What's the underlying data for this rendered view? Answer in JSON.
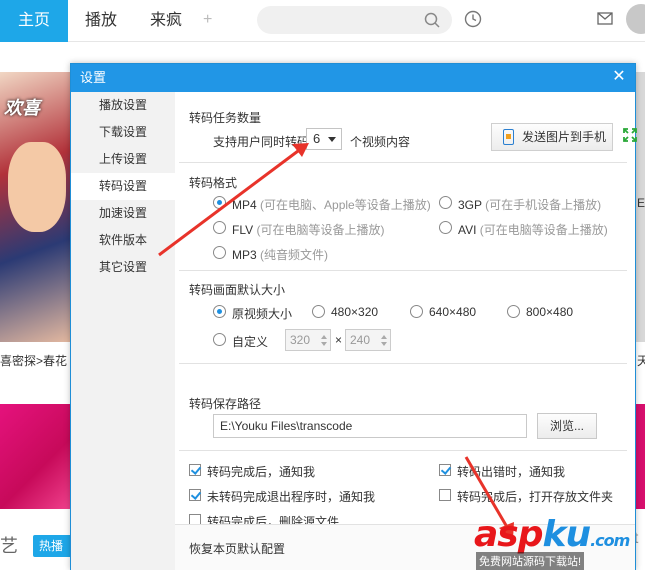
{
  "topbar": {
    "tabs": [
      {
        "label": "主页"
      },
      {
        "label": "播放"
      },
      {
        "label": "来疯"
      }
    ],
    "plus_label": "+"
  },
  "background": {
    "poster_title": "欢喜",
    "left_caption": "喜密探>春花",
    "right_char_top": "E",
    "right_char_bottom": "天",
    "left_bottom_text": "艺",
    "hot_button_label": "热播",
    "right_bottom_fragment": "ot"
  },
  "dialog": {
    "title": "设置",
    "close_label": "✕",
    "nav": [
      {
        "label": "播放设置"
      },
      {
        "label": "下载设置"
      },
      {
        "label": "上传设置"
      },
      {
        "label": "转码设置"
      },
      {
        "label": "加速设置"
      },
      {
        "label": "软件版本"
      },
      {
        "label": "其它设置"
      }
    ],
    "task_count": {
      "title": "转码任务数量",
      "prefix": "支持用户同时转码",
      "value": "6",
      "suffix": "个视频内容",
      "send_button": "发送图片到手机"
    },
    "format": {
      "title": "转码格式",
      "options": [
        {
          "name": "MP4",
          "hint": "(可在电脑、Apple等设备上播放)",
          "selected": true
        },
        {
          "name": "3GP",
          "hint": "(可在手机设备上播放)",
          "selected": false
        },
        {
          "name": "FLV",
          "hint": "(可在电脑等设备上播放)",
          "selected": false
        },
        {
          "name": "AVI",
          "hint": "(可在电脑等设备上播放)",
          "selected": false
        },
        {
          "name": "MP3",
          "hint": "(纯音频文件)",
          "selected": false
        }
      ]
    },
    "size": {
      "title": "转码画面默认大小",
      "options": [
        {
          "label": "原视频大小",
          "selected": true
        },
        {
          "label": "480×320",
          "selected": false
        },
        {
          "label": "640×480",
          "selected": false
        },
        {
          "label": "800×480",
          "selected": false
        }
      ],
      "custom_label": "自定义",
      "custom_width": "320",
      "times": "×",
      "custom_height": "240"
    },
    "path": {
      "title": "转码保存路径",
      "value": "E:\\Youku Files\\transcode",
      "browse_button": "浏览..."
    },
    "checks": [
      {
        "label": "转码完成后，通知我",
        "checked": true
      },
      {
        "label": "转码出错时，通知我",
        "checked": true
      },
      {
        "label": "未转码完成退出程序时，通知我",
        "checked": true
      },
      {
        "label": "转码完成后，打开存放文件夹",
        "checked": false
      },
      {
        "label": "转码完成后，删除源文件",
        "checked": false
      }
    ],
    "restore_link": "恢复本页默认配置"
  },
  "watermark": {
    "main_a": "asp",
    "main_b": "ku",
    "main_c": ".com",
    "sub": "免费网站源码下载站!"
  },
  "colors": {
    "accent": "#1ea7e8",
    "dialog_title": "#2196e6",
    "arrow": "#e8332a",
    "watermark_red": "#e8161a"
  }
}
